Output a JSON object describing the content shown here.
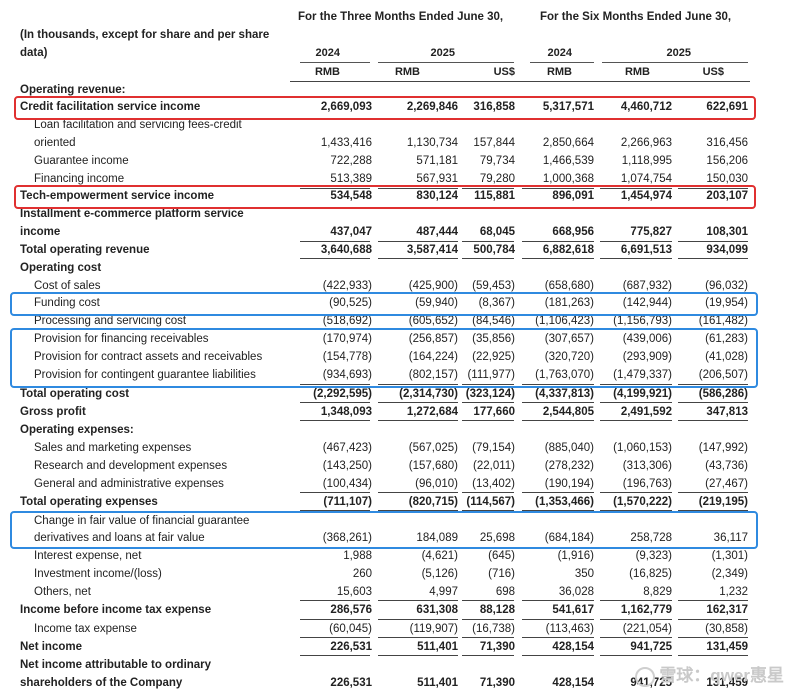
{
  "header": {
    "note": "(In thousands, except for share and per share data)",
    "period_three": "For the Three Months Ended June 30,",
    "period_six": "For the Six Months Ended June 30,",
    "years": [
      "2024",
      "2025",
      "2024",
      "2025"
    ],
    "currencies": [
      "RMB",
      "RMB",
      "US$",
      "RMB",
      "RMB",
      "US$"
    ]
  },
  "rows": [
    {
      "label": "Operating revenue:",
      "values": []
    },
    {
      "label": "Credit facilitation service income",
      "values": [
        "2,669,093",
        "2,269,846",
        "316,858",
        "5,317,571",
        "4,460,712",
        "622,691"
      ]
    },
    {
      "label": "Loan facilitation and servicing fees-credit",
      "values": []
    },
    {
      "label": "oriented",
      "values": [
        "1,433,416",
        "1,130,734",
        "157,844",
        "2,850,664",
        "2,266,963",
        "316,456"
      ]
    },
    {
      "label": "Guarantee income",
      "values": [
        "722,288",
        "571,181",
        "79,734",
        "1,466,539",
        "1,118,995",
        "156,206"
      ]
    },
    {
      "label": "Financing income",
      "values": [
        "513,389",
        "567,931",
        "79,280",
        "1,000,368",
        "1,074,754",
        "150,030"
      ]
    },
    {
      "label": "Tech-empowerment service income",
      "values": [
        "534,548",
        "830,124",
        "115,881",
        "896,091",
        "1,454,974",
        "203,107"
      ]
    },
    {
      "label": "Installment e-commerce platform service",
      "values": []
    },
    {
      "label": "income",
      "values": [
        "437,047",
        "487,444",
        "68,045",
        "668,956",
        "775,827",
        "108,301"
      ]
    },
    {
      "label": "Total operating revenue",
      "values": [
        "3,640,688",
        "3,587,414",
        "500,784",
        "6,882,618",
        "6,691,513",
        "934,099"
      ]
    },
    {
      "label": "Operating cost",
      "values": []
    },
    {
      "label": "Cost of sales",
      "values": [
        "(422,933)",
        "(425,900)",
        "(59,453)",
        "(658,680)",
        "(687,932)",
        "(96,032)"
      ]
    },
    {
      "label": "Funding cost",
      "values": [
        "(90,525)",
        "(59,940)",
        "(8,367)",
        "(181,263)",
        "(142,944)",
        "(19,954)"
      ]
    },
    {
      "label": "Processing and servicing cost",
      "values": [
        "(518,692)",
        "(605,652)",
        "(84,546)",
        "(1,106,423)",
        "(1,156,793)",
        "(161,482)"
      ]
    },
    {
      "label": "Provision for financing receivables",
      "values": [
        "(170,974)",
        "(256,857)",
        "(35,856)",
        "(307,657)",
        "(439,006)",
        "(61,283)"
      ]
    },
    {
      "label": "Provision for contract assets and receivables",
      "values": [
        "(154,778)",
        "(164,224)",
        "(22,925)",
        "(320,720)",
        "(293,909)",
        "(41,028)"
      ]
    },
    {
      "label": "Provision for contingent guarantee liabilities",
      "values": [
        "(934,693)",
        "(802,157)",
        "(111,977)",
        "(1,763,070)",
        "(1,479,337)",
        "(206,507)"
      ]
    },
    {
      "label": "Total operating cost",
      "values": [
        "(2,292,595)",
        "(2,314,730)",
        "(323,124)",
        "(4,337,813)",
        "(4,199,921)",
        "(586,286)"
      ]
    },
    {
      "label": "Gross profit",
      "values": [
        "1,348,093",
        "1,272,684",
        "177,660",
        "2,544,805",
        "2,491,592",
        "347,813"
      ]
    },
    {
      "label": "Operating expenses:",
      "values": []
    },
    {
      "label": "Sales and marketing expenses",
      "values": [
        "(467,423)",
        "(567,025)",
        "(79,154)",
        "(885,040)",
        "(1,060,153)",
        "(147,992)"
      ]
    },
    {
      "label": "Research and development expenses",
      "values": [
        "(143,250)",
        "(157,680)",
        "(22,011)",
        "(278,232)",
        "(313,306)",
        "(43,736)"
      ]
    },
    {
      "label": "General and administrative expenses",
      "values": [
        "(100,434)",
        "(96,010)",
        "(13,402)",
        "(190,194)",
        "(196,763)",
        "(27,467)"
      ]
    },
    {
      "label": "Total operating expenses",
      "values": [
        "(711,107)",
        "(820,715)",
        "(114,567)",
        "(1,353,466)",
        "(1,570,222)",
        "(219,195)"
      ]
    },
    {
      "label": "Change in fair value of financial guarantee",
      "values": []
    },
    {
      "label": "derivatives and loans at fair value",
      "values": [
        "(368,261)",
        "184,089",
        "25,698",
        "(684,184)",
        "258,728",
        "36,117"
      ]
    },
    {
      "label": "Interest expense, net",
      "values": [
        "1,988",
        "(4,621)",
        "(645)",
        "(1,916)",
        "(9,323)",
        "(1,301)"
      ]
    },
    {
      "label": "Investment income/(loss)",
      "values": [
        "260",
        "(5,126)",
        "(716)",
        "350",
        "(16,825)",
        "(2,349)"
      ]
    },
    {
      "label": "Others, net",
      "values": [
        "15,603",
        "4,997",
        "698",
        "36,028",
        "8,829",
        "1,232"
      ]
    },
    {
      "label": "Income before income tax expense",
      "values": [
        "286,576",
        "631,308",
        "88,128",
        "541,617",
        "1,162,779",
        "162,317"
      ]
    },
    {
      "label": "Income tax expense",
      "values": [
        "(60,045)",
        "(119,907)",
        "(16,738)",
        "(113,463)",
        "(221,054)",
        "(30,858)"
      ]
    },
    {
      "label": "Net income",
      "values": [
        "226,531",
        "511,401",
        "71,390",
        "428,154",
        "941,725",
        "131,459"
      ]
    },
    {
      "label": "Net income attributable to ordinary",
      "values": []
    },
    {
      "label": "shareholders of the Company",
      "values": [
        "226,531",
        "511,401",
        "71,390",
        "428,154",
        "941,725",
        "131,459"
      ]
    }
  ],
  "watermark": "雪球：qwer惠星",
  "colors": {
    "red_box": "#e03030",
    "blue_box": "#2f8ae0"
  }
}
